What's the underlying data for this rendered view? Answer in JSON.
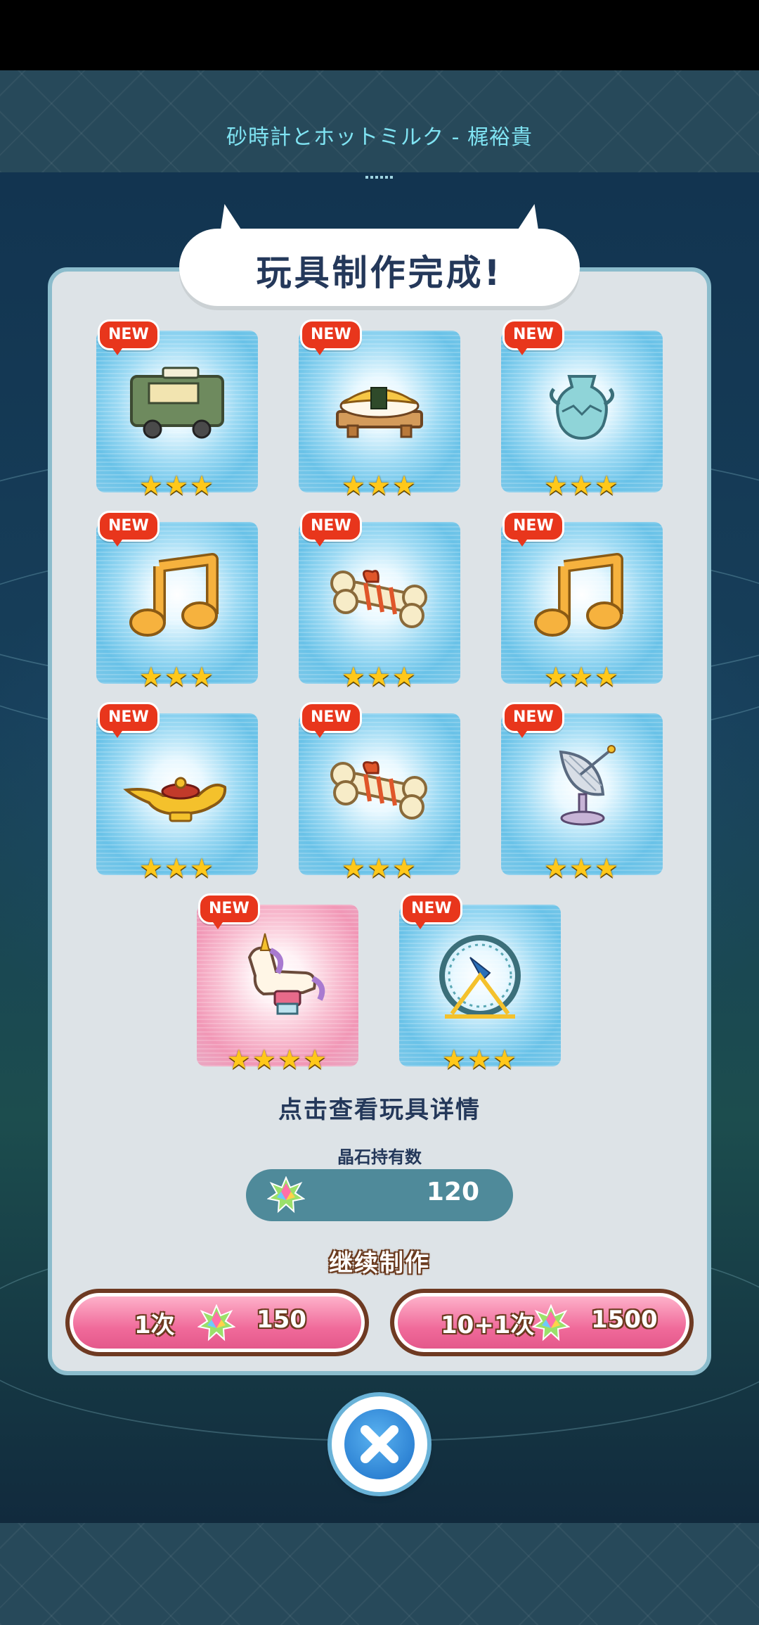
{
  "music": {
    "title": "砂時計とホットミルク - 梶裕貴"
  },
  "panel": {
    "title": "玩具制作完成!"
  },
  "items": [
    {
      "badge": "NEW",
      "stars": "★★★",
      "icon": "food-truck-icon",
      "glow": "blue"
    },
    {
      "badge": "NEW",
      "stars": "★★★",
      "icon": "sushi-icon",
      "glow": "blue"
    },
    {
      "badge": "NEW",
      "stars": "★★★",
      "icon": "vase-icon",
      "glow": "blue"
    },
    {
      "badge": "NEW",
      "stars": "★★★",
      "icon": "music-note-icon",
      "glow": "blue"
    },
    {
      "badge": "NEW",
      "stars": "★★★",
      "icon": "bone-icon",
      "glow": "blue"
    },
    {
      "badge": "NEW",
      "stars": "★★★",
      "icon": "music-note-icon",
      "glow": "blue"
    },
    {
      "badge": "NEW",
      "stars": "★★★",
      "icon": "magic-lamp-icon",
      "glow": "blue"
    },
    {
      "badge": "NEW",
      "stars": "★★★",
      "icon": "bone-icon",
      "glow": "blue"
    },
    {
      "badge": "NEW",
      "stars": "★★★",
      "icon": "satellite-dish-icon",
      "glow": "blue"
    },
    {
      "badge": "NEW",
      "stars": "★★★★",
      "icon": "rocking-unicorn-icon",
      "glow": "pink"
    },
    {
      "badge": "NEW",
      "stars": "★★★",
      "icon": "hamster-wheel-icon",
      "glow": "blue"
    }
  ],
  "hint": "点击查看玩具详情",
  "crystals": {
    "label": "晶石持有数",
    "count": "120"
  },
  "continue": {
    "label": "继续制作",
    "single": {
      "label": "1次",
      "cost": "150"
    },
    "multi": {
      "label": "10+1次",
      "cost": "1500"
    }
  },
  "colors": {
    "panel": "#dde3e7",
    "title": "#24385a",
    "badge": "#e8361c",
    "button": "#f06a9a",
    "star": "#ffc81a"
  }
}
